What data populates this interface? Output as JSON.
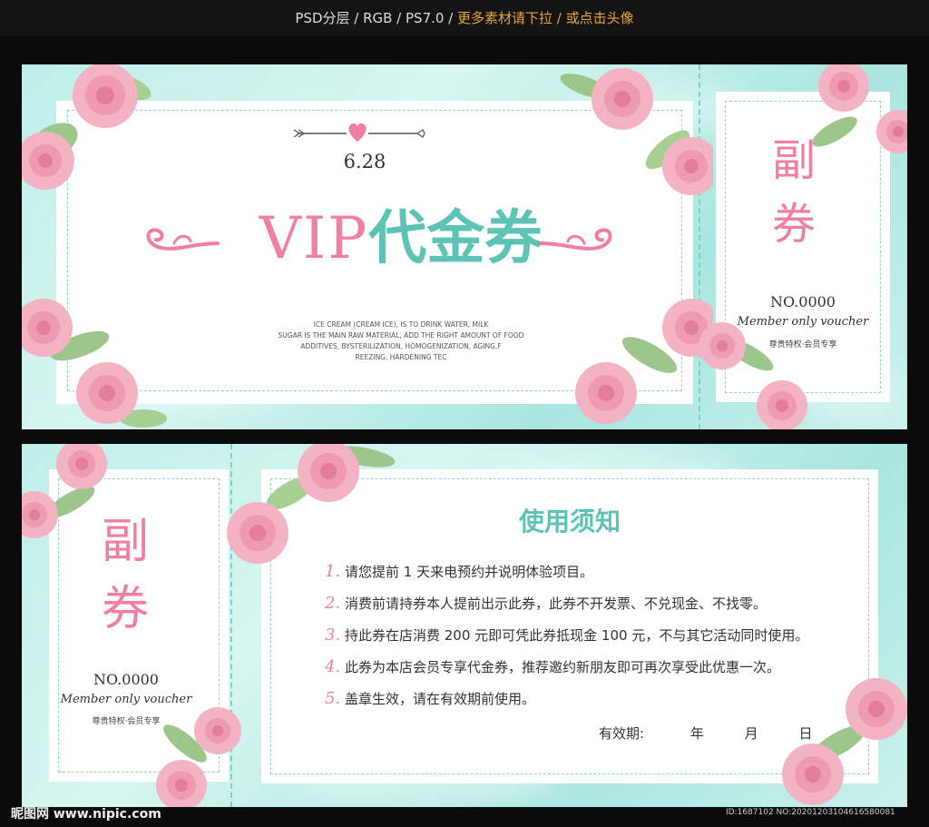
{
  "topbar": {
    "info": "PSD分层 / RGB / PS7.0 / ",
    "promo": "更多素材请下拉 / 或点击头像"
  },
  "main": {
    "date": "6.28",
    "title_vip": "VIP",
    "title_cn": "代金券",
    "desc": [
      "ICE CREAM (CREAM ICE), IS TO DRINK WATER, MILK",
      "SUGAR IS THE MAIN RAW MATERIAL, ADD THE RIGHT AMOUNT OF FOOD",
      "ADDITIVES, BYSTERILIZATION, HOMOGENIZATION, AGING,F",
      "REEZING, HARDENING TEC"
    ]
  },
  "stub": {
    "char1": "副",
    "char2": "券",
    "number": "NO.0000",
    "script": "Member only voucher",
    "sub": "尊贵特权·会员专享"
  },
  "notice": {
    "title": "使用须知",
    "items": [
      {
        "num": "1.",
        "text": "请您提前 1 天来电预约并说明体验项目。"
      },
      {
        "num": "2.",
        "text": "消费前请持券本人提前出示此券，此券不开发票、不兑现金、不找零。"
      },
      {
        "num": "3.",
        "text": "持此券在店消费 200 元即可凭此券抵现金 100 元，不与其它活动同时使用。"
      },
      {
        "num": "4.",
        "text": "此券为本店会员专享代金券，推荐邀约新朋友即可再次享受此优惠一次。"
      },
      {
        "num": "5.",
        "text": "盖章生效，请在有效期前使用。"
      }
    ],
    "validity": "有效期:",
    "year": "年",
    "month": "月",
    "day": "日"
  },
  "watermark": {
    "left": "昵图网 www.nipic.com",
    "right": "ID:1687102 NO:20201203104616580081"
  },
  "colors": {
    "pink": "#f07ea6",
    "teal": "#5cc4b5",
    "mint": "#bfeee9"
  }
}
